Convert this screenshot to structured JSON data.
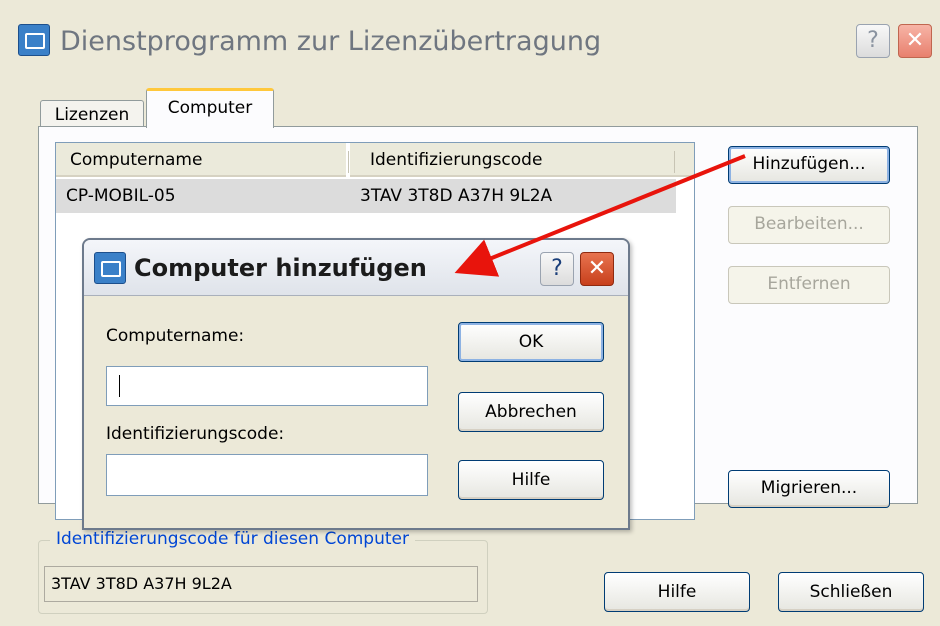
{
  "window": {
    "title": "Dienstprogramm zur Lizenzübertragung",
    "help_label": "?",
    "close_label": "✕"
  },
  "tabs": [
    {
      "label": "Lizenzen",
      "active": false
    },
    {
      "label": "Computer",
      "active": true
    }
  ],
  "list": {
    "columns": [
      "Computername",
      "Identifizierungscode"
    ],
    "rows": [
      {
        "computername": "CP-MOBIL-05",
        "code": "3TAV 3T8D A37H 9L2A"
      }
    ]
  },
  "side_buttons": {
    "add": "Hinzufügen...",
    "edit": "Bearbeiten...",
    "remove": "Entfernen",
    "migrate": "Migrieren..."
  },
  "group": {
    "label": "Identifizierungscode für diesen Computer",
    "value": "3TAV 3T8D A37H 9L2A"
  },
  "footer": {
    "help": "Hilfe",
    "close": "Schließen"
  },
  "dialog": {
    "title": "Computer hinzufügen",
    "help_label": "?",
    "close_label": "✕",
    "computername_label": "Computername:",
    "computername_value": "",
    "code_label": "Identifizierungscode:",
    "code_value": "",
    "ok": "OK",
    "cancel": "Abbrechen",
    "help": "Hilfe"
  },
  "colors": {
    "window_bg": "#ece9d8",
    "annotation_arrow": "#e8140c",
    "group_label": "#0046d5"
  }
}
